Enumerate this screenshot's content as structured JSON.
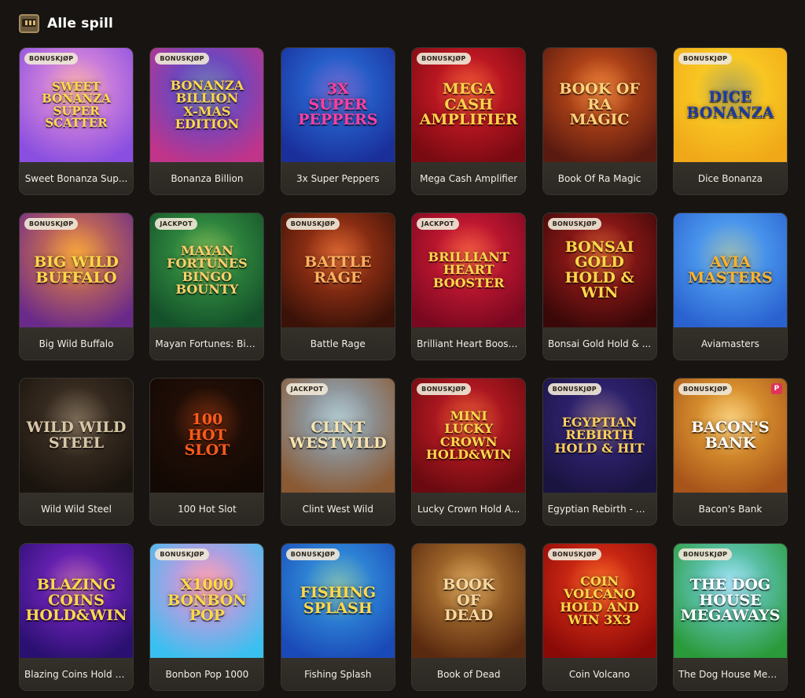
{
  "header": {
    "title": "Alle spill",
    "icon": "slot-machine-icon"
  },
  "games": [
    {
      "name": "Sweet Bonanza Sup...",
      "thumb_title": "Sweet\nBonanza\nSuper\nScatter",
      "badge": "BONUSKJØP",
      "bg1": "#f59cd8",
      "bg2": "#8a4fe0",
      "fg": "#ffd84a"
    },
    {
      "name": "Bonanza Billion",
      "thumb_title": "Bonanza\nBillion\nX-mas Edition",
      "badge": "BONUSKJØP",
      "bg1": "#3a53e0",
      "bg2": "#c0348a",
      "fg": "#ffd84a"
    },
    {
      "name": "3x Super Peppers",
      "thumb_title": "3x\nSuper\nPeppers",
      "badge": "",
      "bg1": "#2c7be6",
      "bg2": "#1a2f9a",
      "fg": "#ff3fa0"
    },
    {
      "name": "Mega Cash Amplifier",
      "thumb_title": "Mega Cash\nAmplifier",
      "badge": "BONUSKJØP",
      "bg1": "#e6202c",
      "bg2": "#7a0a12",
      "fg": "#ffd24a"
    },
    {
      "name": "Book Of Ra Magic",
      "thumb_title": "Book of Ra\nMagic",
      "badge": "",
      "bg1": "#e05a1c",
      "bg2": "#5a1a10",
      "fg": "#ffd27a"
    },
    {
      "name": "Dice Bonanza",
      "thumb_title": "Dice\nBonanza",
      "badge": "BONUSKJØP",
      "bg1": "#ffdc2a",
      "bg2": "#f0a818",
      "fg": "#1b3aa8"
    },
    {
      "name": "Big Wild Buffalo",
      "thumb_title": "Big Wild\nBuffalo",
      "badge": "BONUSKJØP",
      "bg1": "#f08a3a",
      "bg2": "#6a2a8a",
      "fg": "#ffd84a"
    },
    {
      "name": "Mayan Fortunes: Bin...",
      "thumb_title": "Mayan\nFortunes\nBingo Bounty",
      "badge": "JACKPOT",
      "bg1": "#3fa84a",
      "bg2": "#14502a",
      "fg": "#ffd06a"
    },
    {
      "name": "Battle Rage",
      "thumb_title": "Battle\nRage",
      "badge": "BONUSKJØP",
      "bg1": "#c2401a",
      "bg2": "#3a1208",
      "fg": "#ffb060"
    },
    {
      "name": "Brilliant Heart Booster",
      "thumb_title": "Brilliant\nHeart\nBooster",
      "badge": "JACKPOT",
      "bg1": "#e8203a",
      "bg2": "#7a0820",
      "fg": "#ffd84a"
    },
    {
      "name": "Bonsai Gold Hold & ...",
      "thumb_title": "Bonsai\nGold\nHold & Win",
      "badge": "BONUSKJØP",
      "bg1": "#b82020",
      "bg2": "#3a0808",
      "fg": "#ffd84a"
    },
    {
      "name": "Aviamasters",
      "thumb_title": "Avia\nMasters",
      "badge": "",
      "bg1": "#5fb8ff",
      "bg2": "#2a62d0",
      "fg": "#ffb22a"
    },
    {
      "name": "Wild Wild Steel",
      "thumb_title": "Wild Wild\nSteel",
      "badge": "",
      "bg1": "#4a3a2c",
      "bg2": "#1a140e",
      "fg": "#d8c7a8"
    },
    {
      "name": "100 Hot Slot",
      "thumb_title": "100\nHot\nSlot",
      "badge": "",
      "bg1": "#2a1208",
      "bg2": "#120804",
      "fg": "#ff5a1a"
    },
    {
      "name": "Clint West Wild",
      "thumb_title": "Clint\nWestwild",
      "badge": "JACKPOT",
      "bg1": "#8fb8d8",
      "bg2": "#8a5a34",
      "fg": "#f8e4b0"
    },
    {
      "name": "Lucky Crown Hold A...",
      "thumb_title": "Mini\nLucky Crown\nHold&Win",
      "badge": "BONUSKJØP",
      "bg1": "#d8202a",
      "bg2": "#6a0a10",
      "fg": "#ffd84a"
    },
    {
      "name": "Egyptian Rebirth - H...",
      "thumb_title": "Egyptian\nRebirth\nHold & Hit",
      "badge": "BONUSKJØP",
      "bg1": "#3a2a8a",
      "bg2": "#1a1440",
      "fg": "#ffcf5a"
    },
    {
      "name": "Bacon's Bank",
      "thumb_title": "Bacon's\nBank",
      "badge": "BONUSKJØP",
      "bg1": "#f4b43a",
      "bg2": "#a8541a",
      "fg": "#ffffff"
    },
    {
      "name": "Blazing Coins Hold a...",
      "thumb_title": "Blazing\nCoins\nHold&Win",
      "badge": "",
      "bg1": "#8a2ad8",
      "bg2": "#2a1070",
      "fg": "#ffd84a"
    },
    {
      "name": "Bonbon Pop 1000",
      "thumb_title": "x1000\nBonbon Pop",
      "badge": "BONUSKJØP",
      "bg1": "#ff8ad8",
      "bg2": "#3ac0f0",
      "fg": "#ffd84a"
    },
    {
      "name": "Fishing Splash",
      "thumb_title": "Fishing\nSplash",
      "badge": "BONUSKJØP",
      "bg1": "#3aa8e8",
      "bg2": "#1a4ab8",
      "fg": "#ffd84a"
    },
    {
      "name": "Book of Dead",
      "thumb_title": "Book\nof\nDead",
      "badge": "",
      "bg1": "#c88a3a",
      "bg2": "#5a2a10",
      "fg": "#f8d8a0"
    },
    {
      "name": "Coin Volcano",
      "thumb_title": "Coin\nVolcano\nHold and Win 3x3",
      "badge": "BONUSKJØP",
      "bg1": "#f23a1a",
      "bg2": "#8a0a08",
      "fg": "#ffd84a"
    },
    {
      "name": "The Dog House Meg...",
      "thumb_title": "The Dog House\nMegaways",
      "badge": "BONUSKJØP",
      "bg1": "#7ad8f0",
      "bg2": "#2a9a3a",
      "fg": "#ffffff"
    }
  ],
  "corner_flag": {
    "game_index": 17,
    "text": "P"
  }
}
